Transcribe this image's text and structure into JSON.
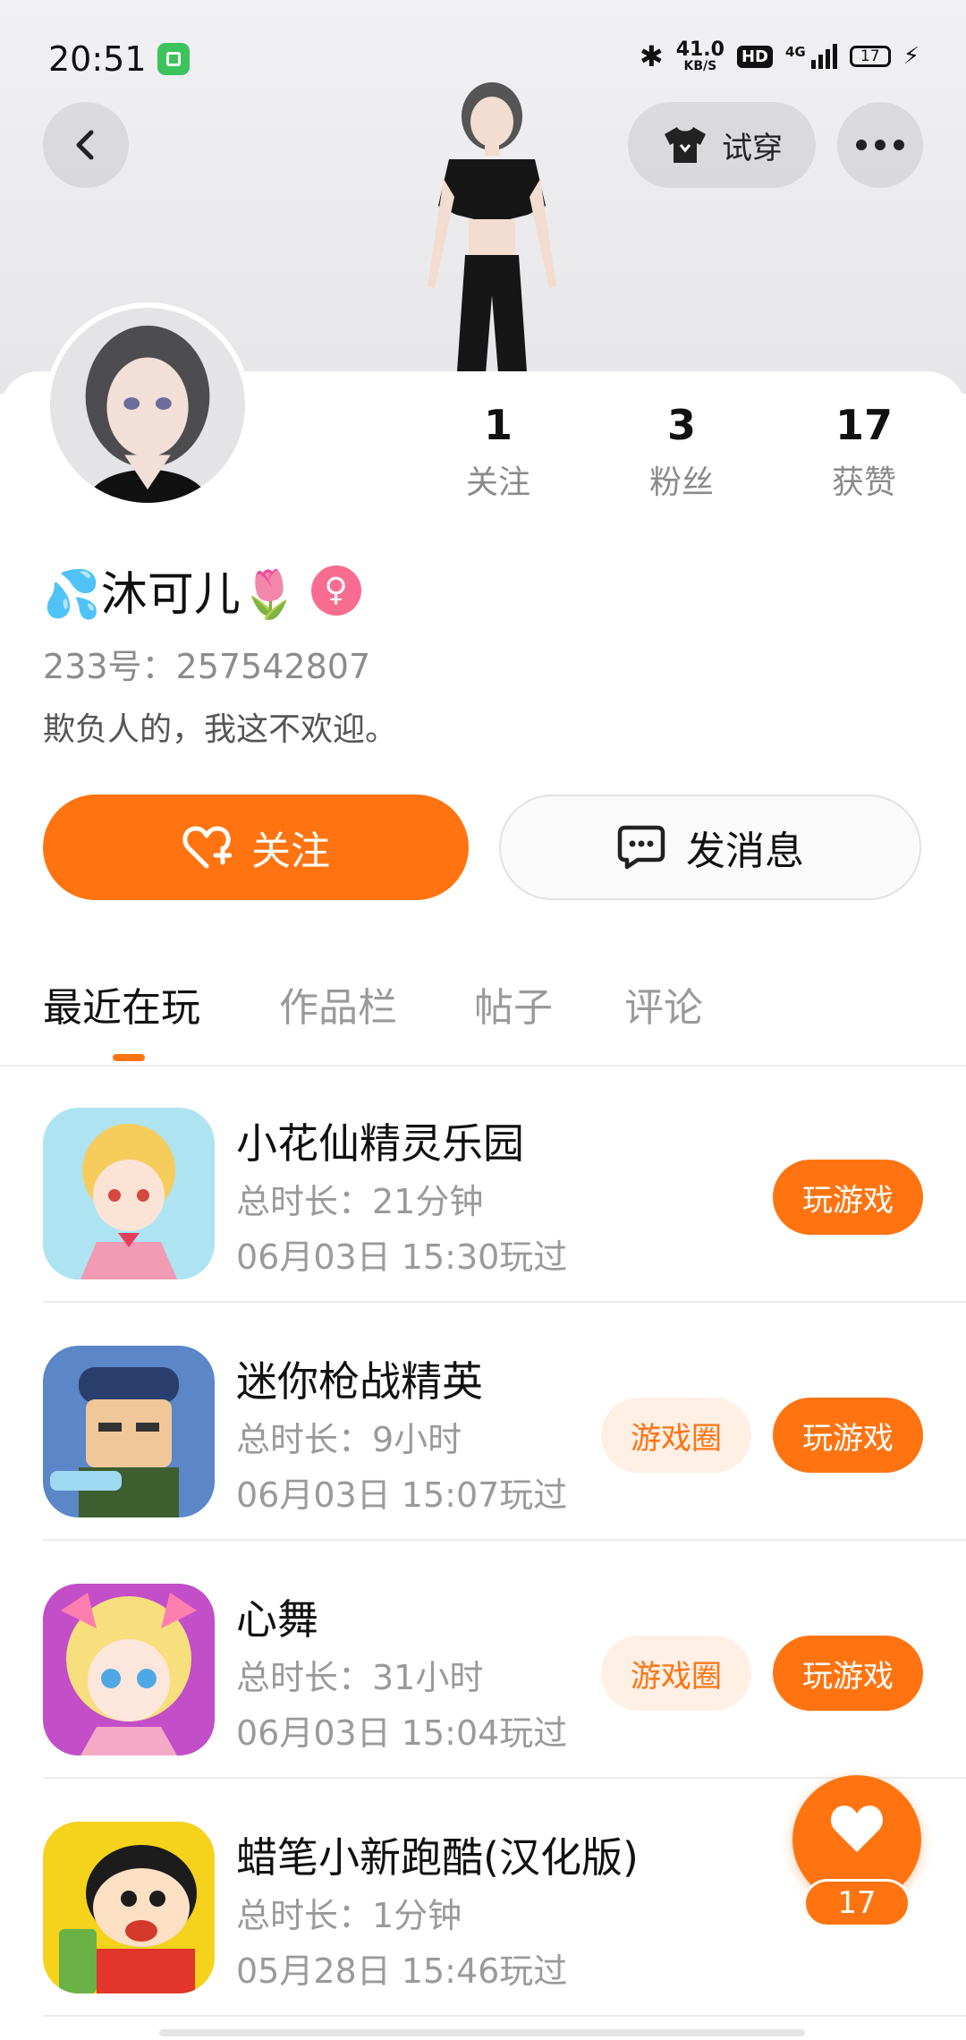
{
  "status_bar": {
    "time": "20:51",
    "net_speed_value": "41.0",
    "net_speed_unit": "KB/S",
    "hd": "HD",
    "network": "4G",
    "battery": "17"
  },
  "header": {
    "tryon_label": "试穿"
  },
  "profile": {
    "stats": [
      {
        "value": "1",
        "label": "关注"
      },
      {
        "value": "3",
        "label": "粉丝"
      },
      {
        "value": "17",
        "label": "获赞"
      }
    ],
    "name": "💦沐可儿🌷",
    "gender_symbol": "♀",
    "uid": "233号：257542807",
    "bio": "欺负人的，我这不欢迎。"
  },
  "actions": {
    "follow_label": "关注",
    "message_label": "发消息"
  },
  "tabs": [
    "最近在玩",
    "作品栏",
    "帖子",
    "评论"
  ],
  "games": [
    {
      "title": "小花仙精灵乐园",
      "duration": "总时长：21分钟",
      "played": "06月03日 15:30玩过",
      "play_label": "玩游戏"
    },
    {
      "title": "迷你枪战精英",
      "duration": "总时长：9小时",
      "played": "06月03日 15:07玩过",
      "circle_label": "游戏圈",
      "play_label": "玩游戏"
    },
    {
      "title": "心舞",
      "duration": "总时长：31小时",
      "played": "06月03日 15:04玩过",
      "circle_label": "游戏圈",
      "play_label": "玩游戏"
    },
    {
      "title": "蜡笔小新跑酷(汉化版)",
      "duration": "总时长：1分钟",
      "played": "05月28日 15:46玩过"
    }
  ],
  "like_fab": {
    "count": "17"
  },
  "colors": {
    "accent": "#ff7411",
    "accent_light": "#fff0e6",
    "gender_pink": "#f86d8f"
  }
}
